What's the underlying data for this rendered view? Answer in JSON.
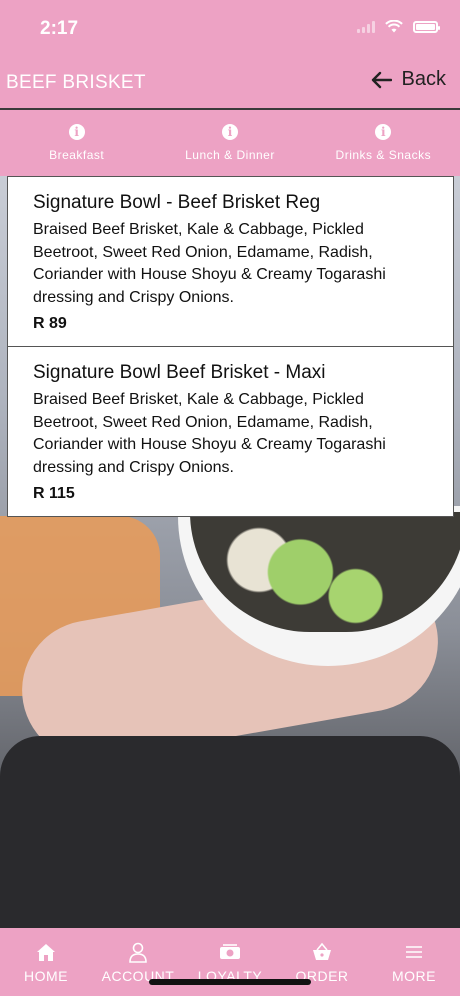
{
  "status_bar": {
    "time": "2:17"
  },
  "header": {
    "title": "BEEF BRISKET",
    "back_label": "Back"
  },
  "tabs": [
    {
      "label": "Breakfast",
      "icon": "info-icon"
    },
    {
      "label": "Lunch & Dinner",
      "icon": "info-icon"
    },
    {
      "label": "Drinks & Snacks",
      "icon": "info-icon"
    }
  ],
  "menu_items": [
    {
      "title": "Signature Bowl - Beef Brisket Reg",
      "description": "Braised Beef Brisket, Kale & Cabbage, Pickled Beetroot, Sweet Red Onion, Edamame, Radish, Coriander with House Shoyu & Creamy Togarashi dressing and Crispy Onions.",
      "price": "R 89"
    },
    {
      "title": "Signature Bowl Beef Brisket - Maxi",
      "description": "Braised Beef Brisket, Kale & Cabbage, Pickled Beetroot, Sweet Red Onion, Edamame, Radish, Coriander with House Shoyu & Creamy Togarashi dressing and Crispy Onions.",
      "price": "R 115"
    }
  ],
  "bottom_nav": [
    {
      "label": "HOME",
      "icon": "home-icon"
    },
    {
      "label": "ACCOUNT",
      "icon": "person-icon"
    },
    {
      "label": "LOYALTY",
      "icon": "loyalty-icon"
    },
    {
      "label": "ORDER",
      "icon": "basket-icon"
    },
    {
      "label": "MORE",
      "icon": "menu-icon"
    }
  ],
  "colors": {
    "accent": "#eda2c4",
    "text": "#111111",
    "card_bg": "#ffffff"
  }
}
